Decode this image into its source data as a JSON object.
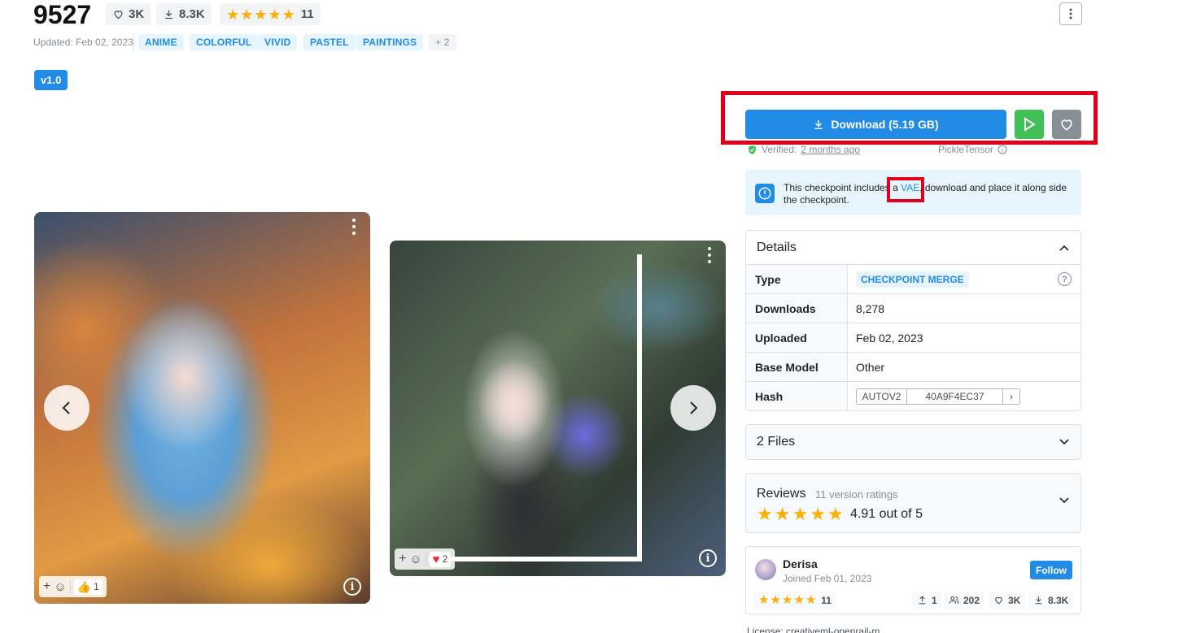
{
  "header": {
    "title": "9527",
    "likes": "3K",
    "downloads": "8.3K",
    "rating_count": "11",
    "updated": "Updated: Feb 02, 2023",
    "tags": [
      "ANIME",
      "COLORFUL",
      "VIVID",
      "PASTEL",
      "PAINTINGS"
    ],
    "more_tags": "+ 2"
  },
  "version": {
    "label": "v1.0"
  },
  "gallery": {
    "image1": {
      "reaction_count": "1"
    },
    "image2": {
      "reaction_count": "2"
    }
  },
  "actions": {
    "download_label": "Download (5.19 GB)",
    "verified_label": "Verified:",
    "verified_when": "2 months ago",
    "pickle": "PickleTensor"
  },
  "alert": {
    "text_before": "This checkpoint includes a ",
    "link": "VAE",
    "text_after": ", download and place it along side the checkpoint."
  },
  "details": {
    "title": "Details",
    "type_label": "Type",
    "type_value": "CHECKPOINT MERGE",
    "downloads_label": "Downloads",
    "downloads_value": "8,278",
    "uploaded_label": "Uploaded",
    "uploaded_value": "Feb 02, 2023",
    "base_model_label": "Base Model",
    "base_model_value": "Other",
    "hash_label": "Hash",
    "hash_type": "AUTOV2",
    "hash_value": "40A9F4EC37"
  },
  "files": {
    "label": "2 Files"
  },
  "reviews": {
    "title": "Reviews",
    "count": "11 version ratings",
    "score": "4.91 out of 5"
  },
  "creator": {
    "name": "Derisa",
    "joined": "Joined Feb 01, 2023",
    "follow_label": "Follow",
    "rating_count": "11",
    "uploads": "1",
    "followers": "202",
    "likes": "3K",
    "downloads": "8.3K"
  },
  "license": {
    "text": "License: creativeml-openrail-m"
  },
  "colors": {
    "accent": "#228be6",
    "success": "#40c057",
    "highlight": "#e0001b",
    "star": "#fab005"
  }
}
